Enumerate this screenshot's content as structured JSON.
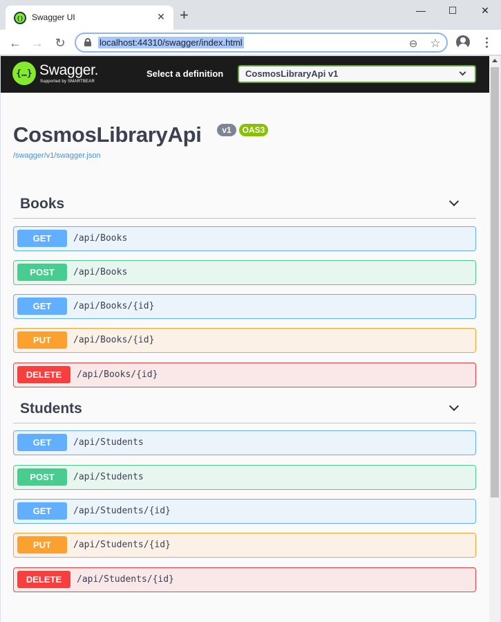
{
  "browser": {
    "tab_title": "Swagger UI",
    "tab_close": "✕",
    "new_tab": "+",
    "url": "localhost:44310/swagger/index.html",
    "win_minimize": "—",
    "win_maximize": "☐",
    "win_close": "✕",
    "back": "←",
    "forward": "→",
    "reload": "↻",
    "zoom_icon": "⊖",
    "star_icon": "☆"
  },
  "topbar": {
    "logo_glyph": "{…}",
    "logo_text": "Swagger.",
    "logo_sub": "Supported by SMARTBEAR",
    "definition_label": "Select a definition",
    "definition_value": "CosmosLibraryApi v1"
  },
  "info": {
    "title": "CosmosLibraryApi",
    "version_badge": "v1",
    "oas_badge": "OAS3",
    "spec_link": "/swagger/v1/swagger.json"
  },
  "colors": {
    "get": "#61affe",
    "post": "#49cc90",
    "put": "#fca130",
    "delete": "#f93e3e",
    "topbar": "#1b1b1b",
    "brand_green": "#85ea2d"
  },
  "tags": [
    {
      "name": "Books",
      "operations": [
        {
          "method": "GET",
          "path": "/api/Books"
        },
        {
          "method": "POST",
          "path": "/api/Books"
        },
        {
          "method": "GET",
          "path": "/api/Books/{id}"
        },
        {
          "method": "PUT",
          "path": "/api/Books/{id}"
        },
        {
          "method": "DELETE",
          "path": "/api/Books/{id}"
        }
      ]
    },
    {
      "name": "Students",
      "operations": [
        {
          "method": "GET",
          "path": "/api/Students"
        },
        {
          "method": "POST",
          "path": "/api/Students"
        },
        {
          "method": "GET",
          "path": "/api/Students/{id}"
        },
        {
          "method": "PUT",
          "path": "/api/Students/{id}"
        },
        {
          "method": "DELETE",
          "path": "/api/Students/{id}"
        }
      ]
    }
  ]
}
